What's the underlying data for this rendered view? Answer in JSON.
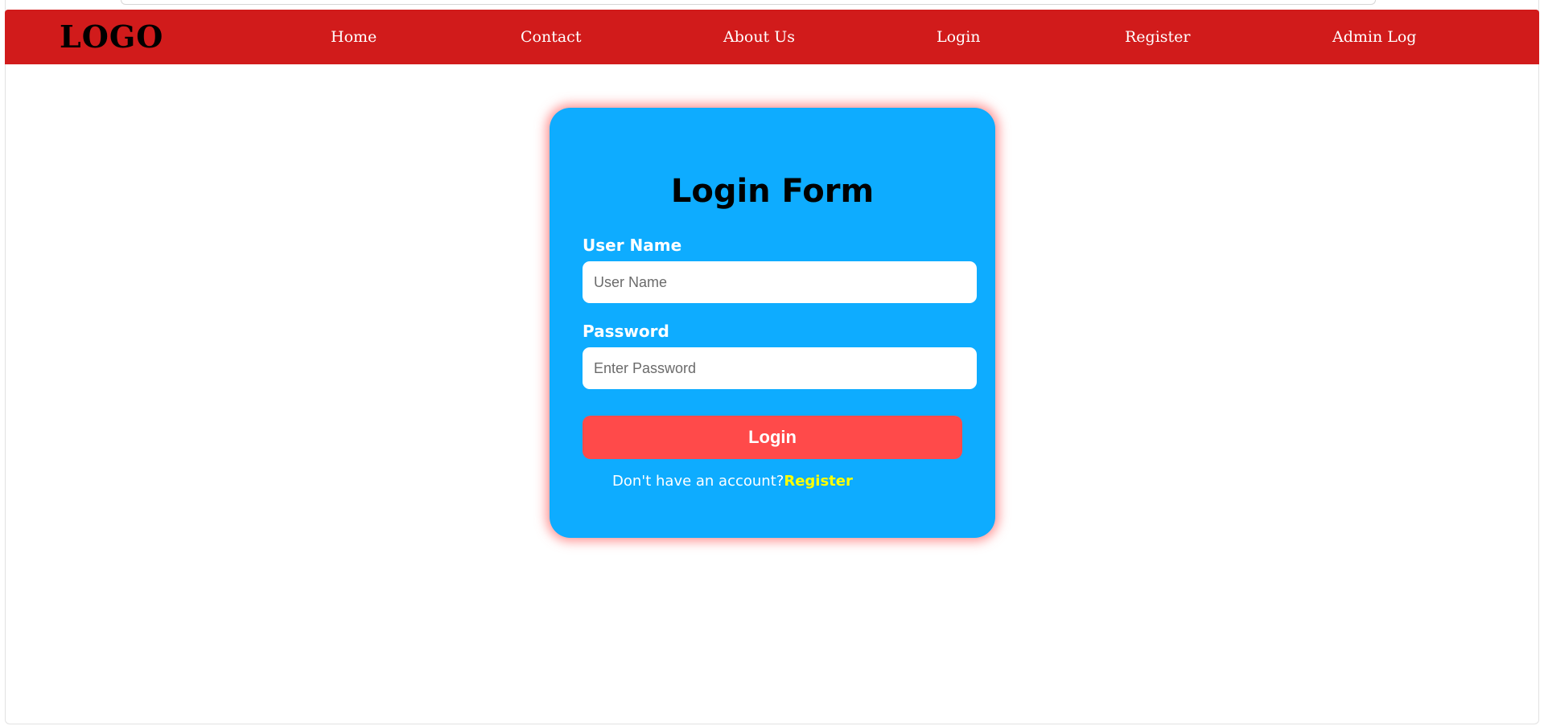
{
  "navbar": {
    "logo": "LOGO",
    "links": [
      {
        "label": "Home"
      },
      {
        "label": "Contact"
      },
      {
        "label": "About Us"
      },
      {
        "label": "Login"
      },
      {
        "label": "Register"
      },
      {
        "label": "Admin Log"
      }
    ]
  },
  "login_form": {
    "title": "Login Form",
    "username": {
      "label": "User Name",
      "placeholder": "User Name",
      "value": ""
    },
    "password": {
      "label": "Password",
      "placeholder": "Enter Password",
      "value": ""
    },
    "submit_label": "Login",
    "register_prompt": "Don't have an account?",
    "register_link": "Register"
  },
  "colors": {
    "navbar_bg": "#d11b1b",
    "card_bg": "#0eacff",
    "card_glow": "#ff6e6e",
    "button_bg": "#ff4a4a",
    "register_link": "#ffff00"
  }
}
